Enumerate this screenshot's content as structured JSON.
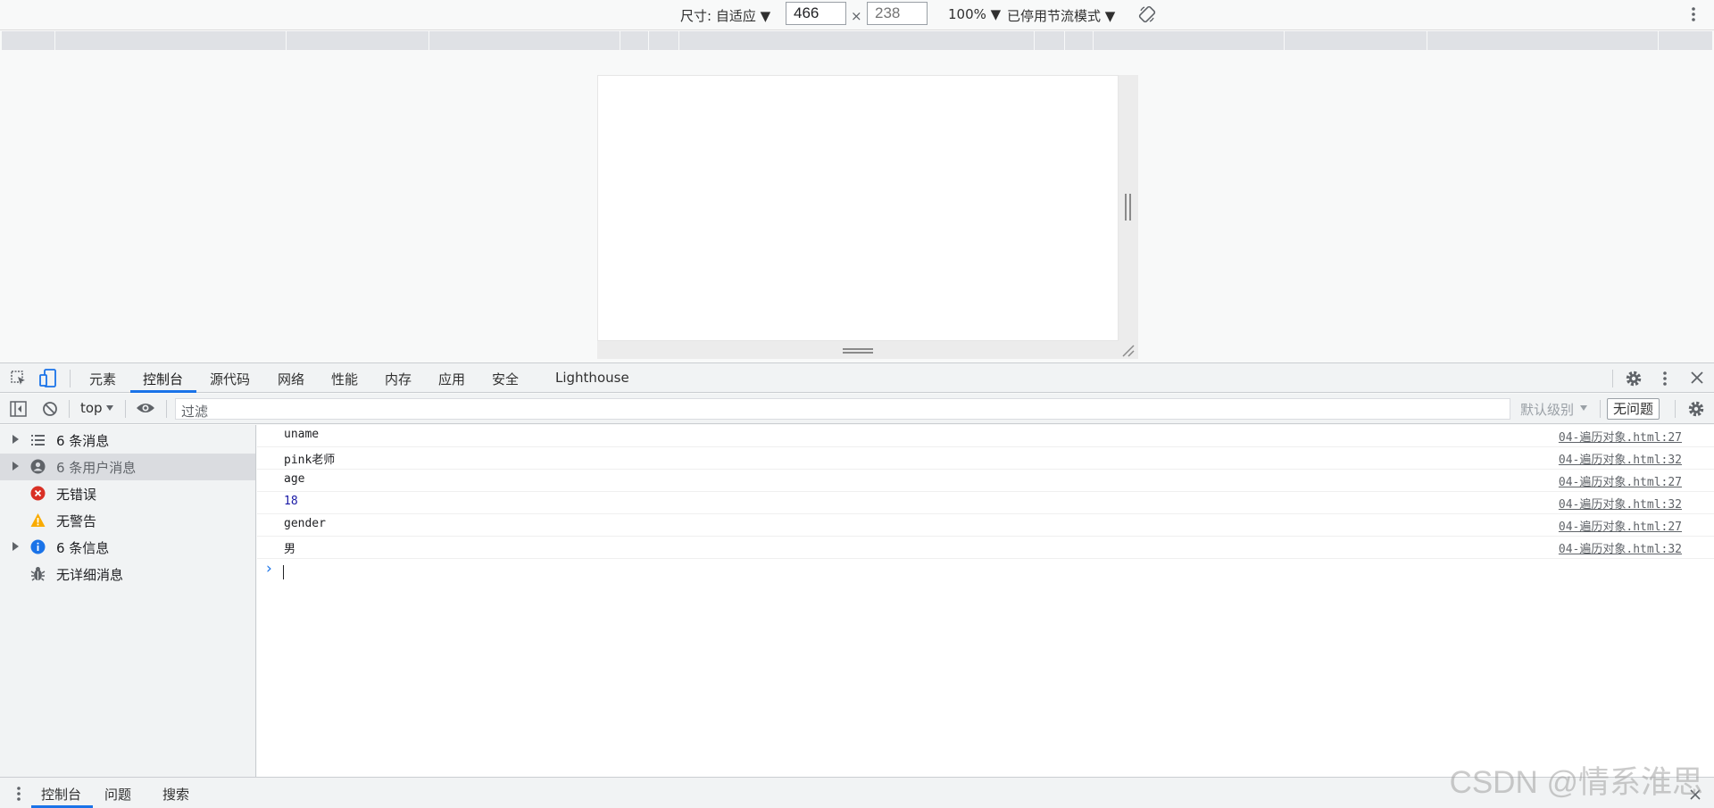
{
  "device_toolbar": {
    "dimensions_label": "尺寸: 自适应 ▼",
    "width_value": "466",
    "times": "×",
    "height_placeholder": "238",
    "zoom": "100% ▼",
    "throttle": "已停用节流模式 ▼"
  },
  "panel_tabs": [
    "元素",
    "控制台",
    "源代码",
    "网络",
    "性能",
    "内存",
    "应用",
    "安全",
    "Lighthouse"
  ],
  "console_toolbar": {
    "context": "top",
    "filter_placeholder": "过滤",
    "levels": "默认级别",
    "issues": "无问题"
  },
  "sidebar": [
    {
      "label": "6 条消息",
      "icon": "list-icon",
      "expandable": true
    },
    {
      "label": "6 条用户消息",
      "icon": "user-icon",
      "expandable": true,
      "selected": true
    },
    {
      "label": "无错误",
      "icon": "error-icon",
      "expandable": false
    },
    {
      "label": "无警告",
      "icon": "warning-icon",
      "expandable": false
    },
    {
      "label": "6 条信息",
      "icon": "info-icon",
      "expandable": true
    },
    {
      "label": "无详细消息",
      "icon": "bug-icon",
      "expandable": false
    }
  ],
  "messages": [
    {
      "text": "uname",
      "source": "04-遍历对象.html:27",
      "type": "string"
    },
    {
      "text": "pink老师",
      "source": "04-遍历对象.html:32",
      "type": "string"
    },
    {
      "text": "age",
      "source": "04-遍历对象.html:27",
      "type": "string"
    },
    {
      "text": "18",
      "source": "04-遍历对象.html:32",
      "type": "number"
    },
    {
      "text": "gender",
      "source": "04-遍历对象.html:27",
      "type": "string"
    },
    {
      "text": "男",
      "source": "04-遍历对象.html:32",
      "type": "string"
    }
  ],
  "prompt_symbol": "›",
  "drawer_tabs": [
    "控制台",
    "问题",
    "搜索"
  ],
  "watermark": "CSDN @情系淮思",
  "colors": {
    "accent": "#1a73e8",
    "error": "#d93025",
    "warning": "#f9ab00",
    "info": "#1a73e8"
  }
}
